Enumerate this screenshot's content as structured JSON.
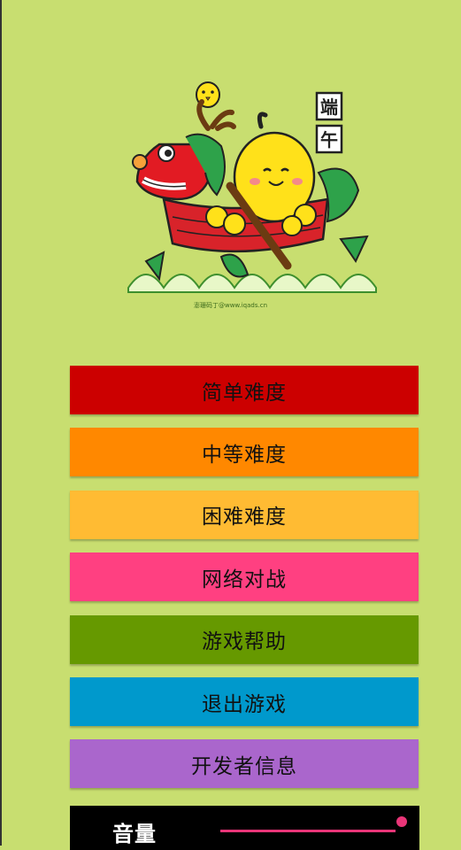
{
  "colors": {
    "background": "#c8de70",
    "accent": "#e93578"
  },
  "banner": {
    "badge_chars": [
      "端",
      "午"
    ],
    "credit": "澎珊码丁@www.iqads.cn"
  },
  "menu": [
    {
      "label": "简单难度",
      "color": "#cc0000"
    },
    {
      "label": "中等难度",
      "color": "#ff8800"
    },
    {
      "label": "困难难度",
      "color": "#ffbb33"
    },
    {
      "label": "网络对战",
      "color": "#ff4081"
    },
    {
      "label": "游戏帮助",
      "color": "#669900"
    },
    {
      "label": "退出游戏",
      "color": "#0099cc"
    },
    {
      "label": "开发者信息",
      "color": "#aa66cc"
    }
  ],
  "volume": {
    "label": "音量",
    "level": 1.0
  }
}
